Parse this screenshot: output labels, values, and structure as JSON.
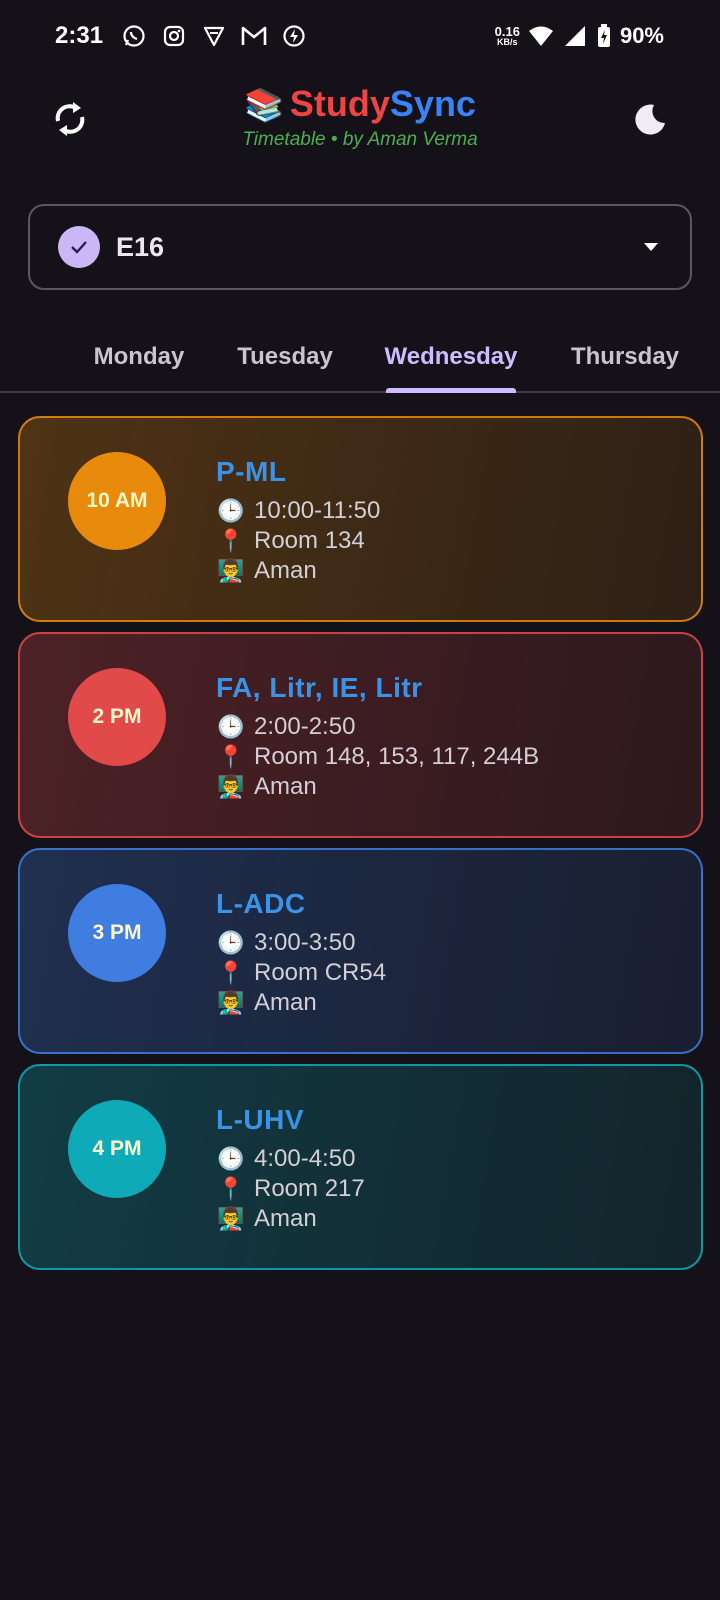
{
  "status_bar": {
    "time": "2:31",
    "net_speed_value": "0.16",
    "net_speed_unit": "KB/s",
    "battery": "90%",
    "icons": [
      "whatsapp-icon",
      "instagram-icon",
      "vpn-icon",
      "gmail-icon",
      "bolt-icon",
      "wifi-icon",
      "signal-icon",
      "battery-icon"
    ]
  },
  "header": {
    "emoji": "📚",
    "title_part1": "Study",
    "title_part2": "Sync",
    "subtitle": "Timetable • by Aman Verma",
    "refresh_icon": "refresh-icon",
    "theme_icon": "moon-icon"
  },
  "section": {
    "value": "E16"
  },
  "tabs": [
    "Monday",
    "Tuesday",
    "Wednesday",
    "Thursday"
  ],
  "active_tab": "Wednesday",
  "emoji": {
    "clock": "🕒",
    "pin": "📍",
    "teacher": "👨‍🏫"
  },
  "classes": [
    {
      "badge": "10 AM",
      "subject": "P-ML",
      "time": "10:00-11:50",
      "room": "Room 134",
      "teacher": "Aman",
      "color": "#e88a0c"
    },
    {
      "badge": "2 PM",
      "subject": "FA, Litr, IE, Litr",
      "time": "2:00-2:50",
      "room": "Room 148, 153, 117, 244B",
      "teacher": "Aman",
      "color": "#e24a4a"
    },
    {
      "badge": "3 PM",
      "subject": "L-ADC",
      "time": "3:00-3:50",
      "room": "Room CR54",
      "teacher": "Aman",
      "color": "#3f7de0"
    },
    {
      "badge": "4 PM",
      "subject": "L-UHV",
      "time": "4:00-4:50",
      "room": "Room 217",
      "teacher": "Aman",
      "color": "#0eaab8"
    }
  ]
}
